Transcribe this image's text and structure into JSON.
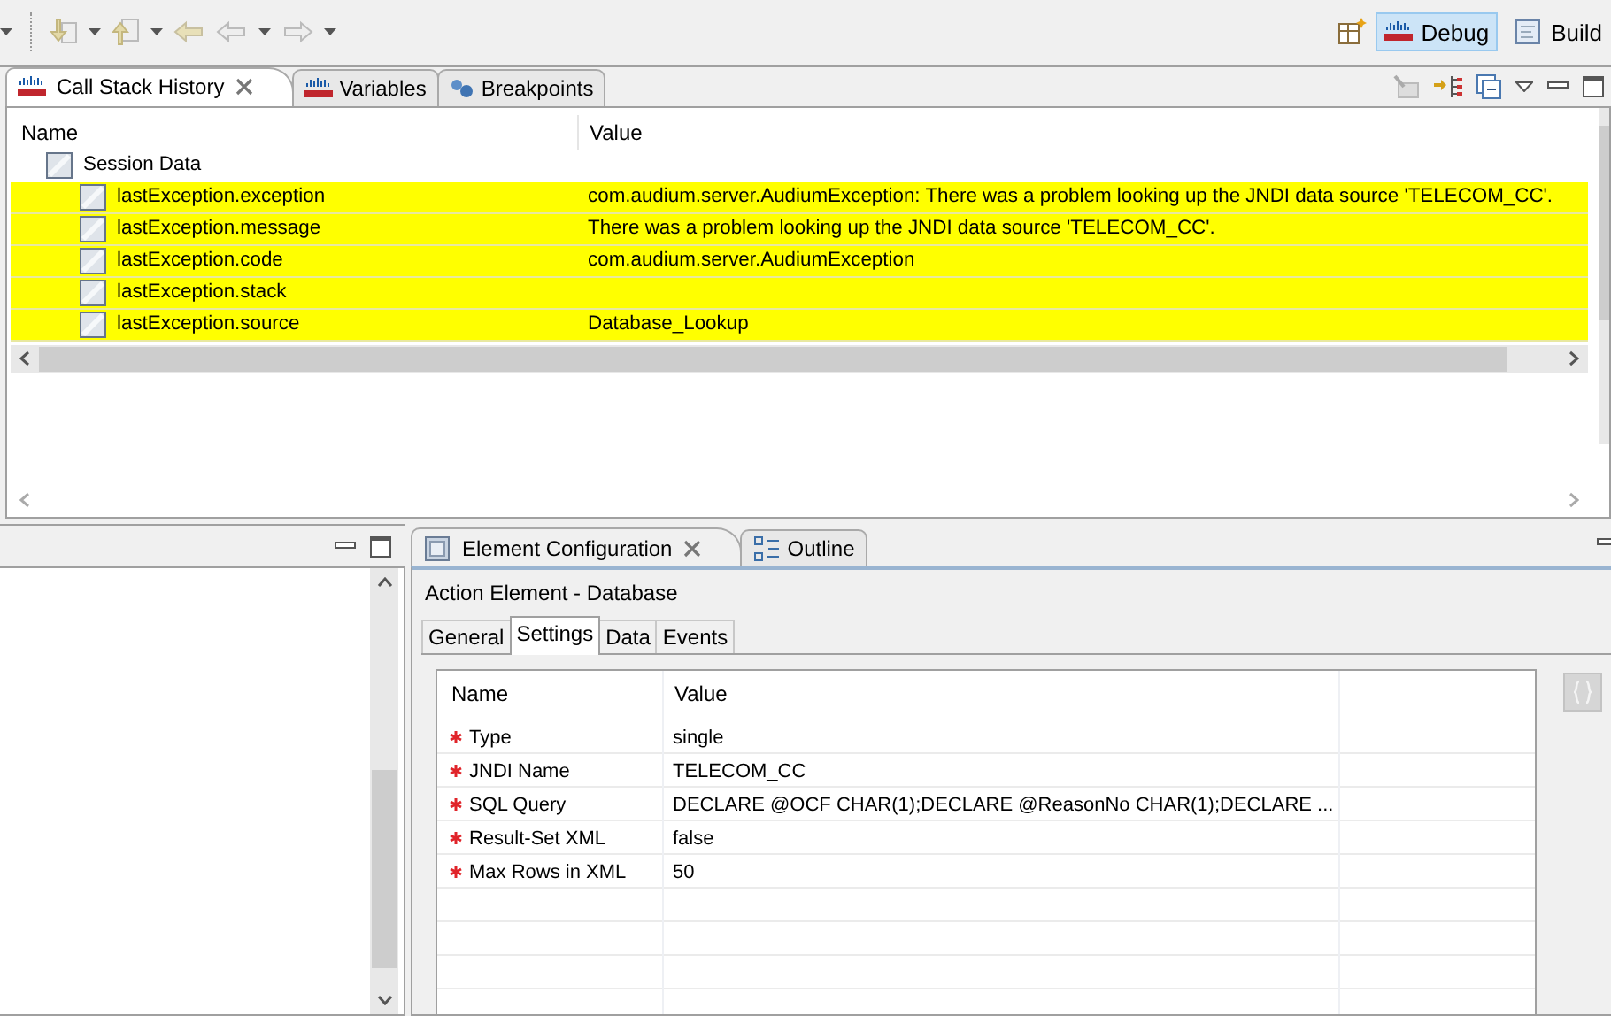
{
  "toolbar": {
    "perspectives": [
      {
        "label": "Debug",
        "selected": true
      },
      {
        "label": "Build",
        "selected": false
      }
    ]
  },
  "top_view": {
    "tabs": [
      {
        "label": "Call Stack History",
        "selected": true
      },
      {
        "label": "Variables",
        "selected": false
      },
      {
        "label": "Breakpoints",
        "selected": false
      }
    ],
    "table": {
      "columns": [
        "Name",
        "Value"
      ],
      "rows": [
        {
          "name": "Session Data",
          "highlighted": false,
          "children": [
            {
              "name": "lastException.exception",
              "value": "com.audium.server.AudiumException: There was a problem looking up the JNDI data source 'TELECOM_CC'.",
              "highlighted": true
            },
            {
              "name": "lastException.message",
              "value": "There was a problem looking up the JNDI data source 'TELECOM_CC'.",
              "highlighted": true
            },
            {
              "name": "lastException.code",
              "value": "com.audium.server.AudiumException",
              "highlighted": true
            },
            {
              "name": "lastException.stack",
              "highlighted": true
            },
            {
              "name": "lastException.source",
              "value": "Database_Lookup",
              "highlighted": true
            }
          ]
        }
      ]
    }
  },
  "bottom_view": {
    "tabs": [
      {
        "label": "Element Configuration",
        "selected": true
      },
      {
        "label": "Outline",
        "selected": false
      }
    ],
    "title": "Action Element - Database",
    "subtabs": [
      {
        "label": "General",
        "selected": false
      },
      {
        "label": "Settings",
        "selected": true
      },
      {
        "label": "Data",
        "selected": false
      },
      {
        "label": "Events",
        "selected": false
      }
    ],
    "table": {
      "columns": [
        "Name",
        "Value"
      ],
      "rows": [
        {
          "name": "Type",
          "value": "single",
          "required": true
        },
        {
          "name": "JNDI Name",
          "value": "TELECOM_CC",
          "required": true
        },
        {
          "name": "SQL Query",
          "value": "DECLARE @OCF CHAR(1);DECLARE @ReasonNo CHAR(1);DECLARE ...",
          "required": true
        },
        {
          "name": "Result-Set XML",
          "value": "false",
          "required": true
        },
        {
          "name": "Max Rows in XML",
          "value": "50",
          "required": true
        }
      ]
    }
  }
}
